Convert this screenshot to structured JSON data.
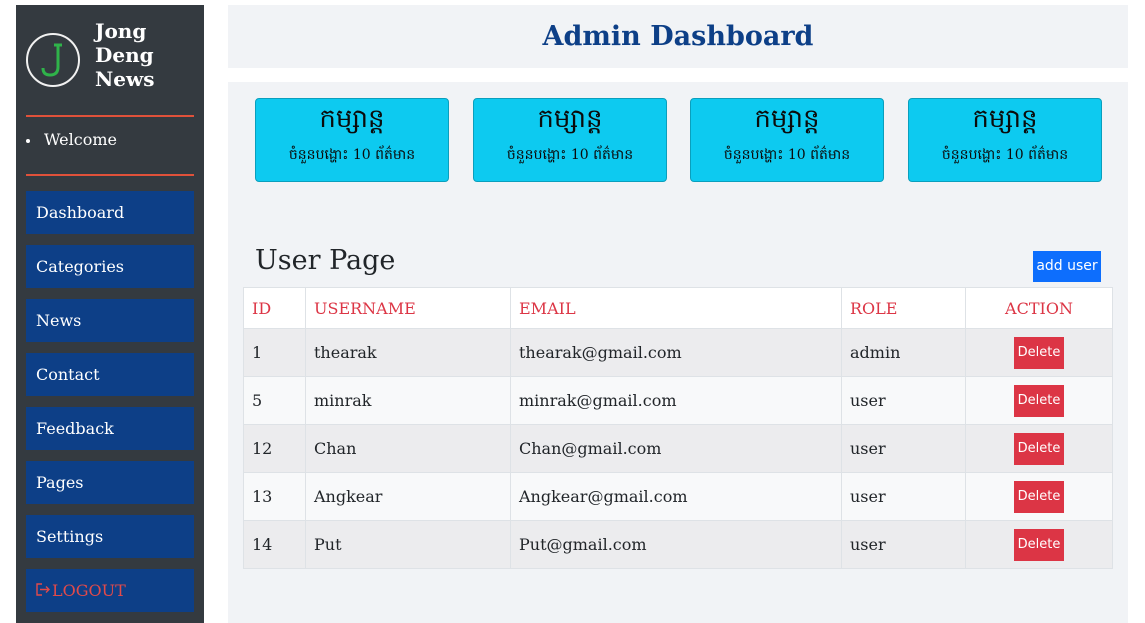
{
  "brand": {
    "name_lines": [
      "Jong",
      "Deng",
      "News"
    ]
  },
  "sidebar": {
    "welcome": "Welcome",
    "items": [
      {
        "label": "Dashboard"
      },
      {
        "label": "Categories"
      },
      {
        "label": "News"
      },
      {
        "label": "Contact"
      },
      {
        "label": "Feedback"
      },
      {
        "label": "Pages"
      },
      {
        "label": "Settings"
      }
    ],
    "logout_icon": "sign-out-icon",
    "logout_label": "LOGOUT"
  },
  "header": {
    "title": "Admin Dashboard"
  },
  "cards": [
    {
      "title": "កម្សាន្ត",
      "subtitle": "ចំនួនបង្ហោះ 10 ព័ត៌មាន"
    },
    {
      "title": "កម្សាន្ត",
      "subtitle": "ចំនួនបង្ហោះ 10 ព័ត៌មាន"
    },
    {
      "title": "កម្សាន្ត",
      "subtitle": "ចំនួនបង្ហោះ 10 ព័ត៌មាន"
    },
    {
      "title": "កម្សាន្ត",
      "subtitle": "ចំនួនបង្ហោះ 10 ព័ត៌មាន"
    }
  ],
  "user_page": {
    "title": "User Page",
    "add_button": "add user",
    "columns": [
      "ID",
      "USERNAME",
      "EMAIL",
      "ROLE",
      "ACTION"
    ],
    "rows": [
      {
        "id": "1",
        "username": "thearak",
        "email": "thearak@gmail.com",
        "role": "admin",
        "action": "Delete"
      },
      {
        "id": "5",
        "username": "minrak",
        "email": "minrak@gmail.com",
        "role": "user",
        "action": "Delete"
      },
      {
        "id": "12",
        "username": "Chan",
        "email": "Chan@gmail.com",
        "role": "user",
        "action": "Delete"
      },
      {
        "id": "13",
        "username": "Angkear",
        "email": "Angkear@gmail.com",
        "role": "user",
        "action": "Delete"
      },
      {
        "id": "14",
        "username": "Put",
        "email": "Put@gmail.com",
        "role": "user",
        "action": "Delete"
      }
    ]
  },
  "colors": {
    "sidebar_bg": "#343a40",
    "nav_bg": "#0d3f87",
    "accent_rule": "#e0513a",
    "card_bg": "#0dcaf0",
    "primary_button": "#0d6efd",
    "danger": "#dc3545"
  }
}
